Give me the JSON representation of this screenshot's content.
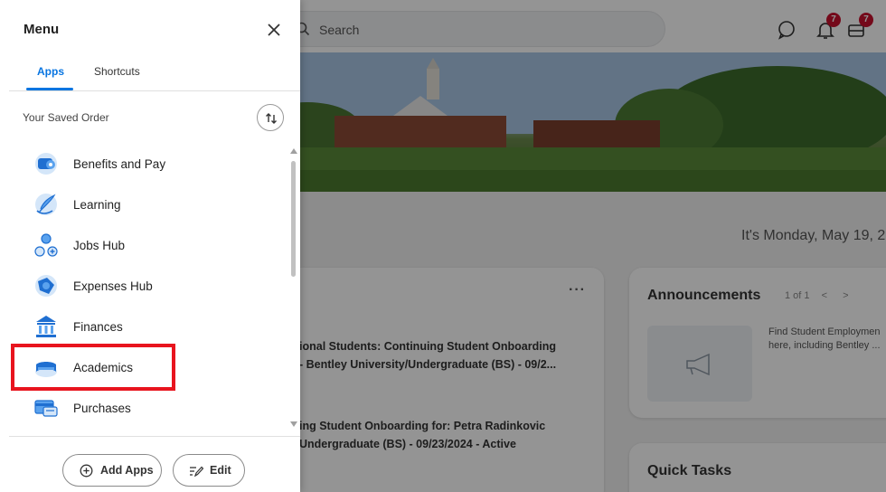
{
  "background": {
    "search_placeholder": "Search",
    "notification_count": "7",
    "inbox_count": "7",
    "greeting": "It's Monday, May 19, 2",
    "tasks": [
      "ional Students: Continuing Student Onboarding",
      "- Bentley University/Undergraduate (BS) - 09/2...",
      "ing Student Onboarding for: Petra Radinkovic",
      "Undergraduate (BS) - 09/23/2024 - Active"
    ],
    "announcements": {
      "title": "Announcements",
      "pager": "1 of 1",
      "text_line1": "Find Student Employmen",
      "text_line2": "here, including Bentley ..."
    },
    "quick_tasks_title": "Quick Tasks"
  },
  "menu": {
    "title": "Menu",
    "tabs": [
      {
        "label": "Apps",
        "active": true
      },
      {
        "label": "Shortcuts",
        "active": false
      }
    ],
    "saved_order_label": "Your Saved Order",
    "items": [
      {
        "label": "Benefits and Pay",
        "icon": "benefits-icon"
      },
      {
        "label": "Learning",
        "icon": "learning-icon"
      },
      {
        "label": "Jobs Hub",
        "icon": "jobs-hub-icon"
      },
      {
        "label": "Expenses Hub",
        "icon": "expenses-icon"
      },
      {
        "label": "Finances",
        "icon": "finances-icon"
      },
      {
        "label": "Academics",
        "icon": "academics-icon",
        "highlighted": true
      },
      {
        "label": "Purchases",
        "icon": "purchases-icon"
      }
    ],
    "add_apps_label": "Add Apps",
    "edit_label": "Edit"
  },
  "colors": {
    "accent": "#0875e1",
    "highlight": "#e8141e",
    "badge": "#c8102e"
  }
}
